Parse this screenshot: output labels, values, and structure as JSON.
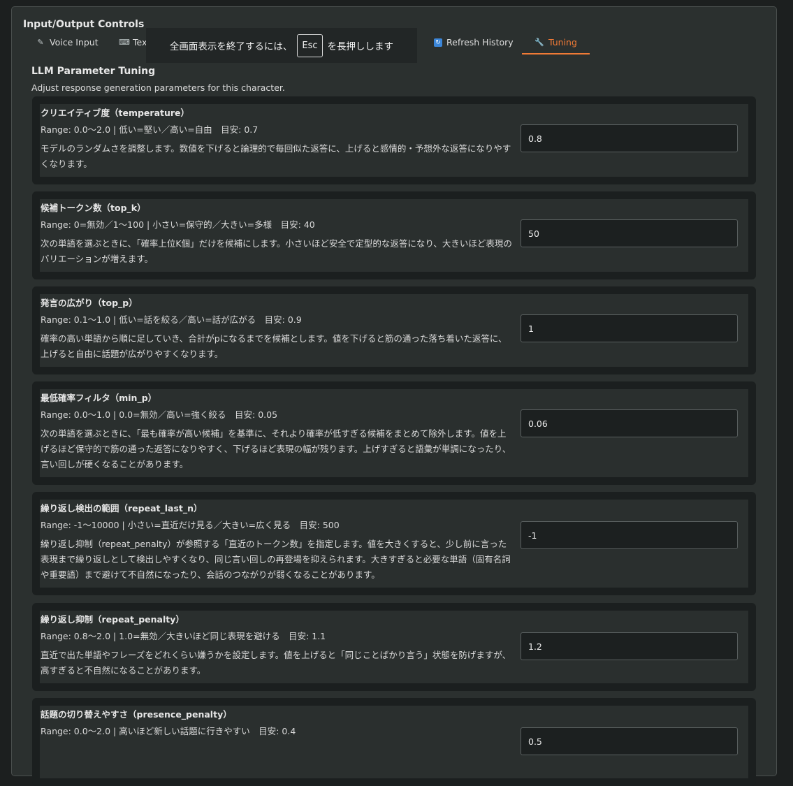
{
  "panel": {
    "title": "Input/Output Controls"
  },
  "tabs": [
    {
      "label": "Voice Input",
      "icon": "microphone-icon"
    },
    {
      "label": "Tex",
      "icon": "keyboard-icon"
    },
    {
      "label": "Refresh History",
      "icon": "refresh-icon"
    },
    {
      "label": "Tuning",
      "icon": "wrench-icon",
      "active": true
    }
  ],
  "toast": {
    "before": "全画面表示を終了するには、",
    "key": "Esc",
    "after": "を長押しします"
  },
  "section": {
    "title": "LLM Parameter Tuning",
    "subtitle": "Adjust response generation parameters for this character."
  },
  "params": [
    {
      "label": "クリエイティブ度（temperature）",
      "range": "Range: 0.0〜2.0 | 低い=堅い／高い=自由　目安: 0.7",
      "desc": "モデルのランダムさを調整します。数値を下げると論理的で毎回似た返答に、上げると感情的・予想外な返答になりやすくなります。",
      "value": "0.8"
    },
    {
      "label": "候補トークン数（top_k）",
      "range": "Range: 0=無効／1〜100 | 小さい=保守的／大きい=多様　目安: 40",
      "desc": "次の単語を選ぶときに、「確率上位K個」だけを候補にします。小さいほど安全で定型的な返答になり、大きいほど表現のバリエーションが増えます。",
      "value": "50"
    },
    {
      "label": "発言の広がり（top_p）",
      "range": "Range: 0.1〜1.0 | 低い=話を絞る／高い=話が広がる　目安: 0.9",
      "desc": "確率の高い単語から順に足していき、合計がpになるまでを候補とします。値を下げると筋の通った落ち着いた返答に、上げると自由に話題が広がりやすくなります。",
      "value": "1"
    },
    {
      "label": "最低確率フィルタ（min_p）",
      "range": "Range: 0.0〜1.0 | 0.0=無効／高い=強く絞る　目安: 0.05",
      "desc": "次の単語を選ぶときに、「最も確率が高い候補」を基準に、それより確率が低すぎる候補をまとめて除外します。値を上げるほど保守的で筋の通った返答になりやすく、下げるほど表現の幅が残ります。上げすぎると語彙が単調になったり、言い回しが硬くなることがあります。",
      "value": "0.06"
    },
    {
      "label": "繰り返し検出の範囲（repeat_last_n）",
      "range": "Range: -1〜10000 | 小さい=直近だけ見る／大きい=広く見る　目安: 500",
      "desc": "繰り返し抑制（repeat_penalty）が参照する「直近のトークン数」を指定します。値を大きくすると、少し前に言った表現まで繰り返しとして検出しやすくなり、同じ言い回しの再登場を抑えられます。大きすぎると必要な単語（固有名詞や重要語）まで避けて不自然になったり、会話のつながりが弱くなることがあります。",
      "value": "-1"
    },
    {
      "label": "繰り返し抑制（repeat_penalty）",
      "range": "Range: 0.8〜2.0 | 1.0=無効／大きいほど同じ表現を避ける　目安: 1.1",
      "desc": "直近で出た単語やフレーズをどれくらい嫌うかを設定します。値を上げると「同じことばかり言う」状態を防げますが、高すぎると不自然になることがあります。",
      "value": "1.2"
    },
    {
      "label": "話題の切り替えやすさ（presence_penalty）",
      "range": "Range: 0.0〜2.0 | 高いほど新しい話題に行きやすい　目安: 0.4",
      "desc": "",
      "value": "0.5"
    }
  ]
}
